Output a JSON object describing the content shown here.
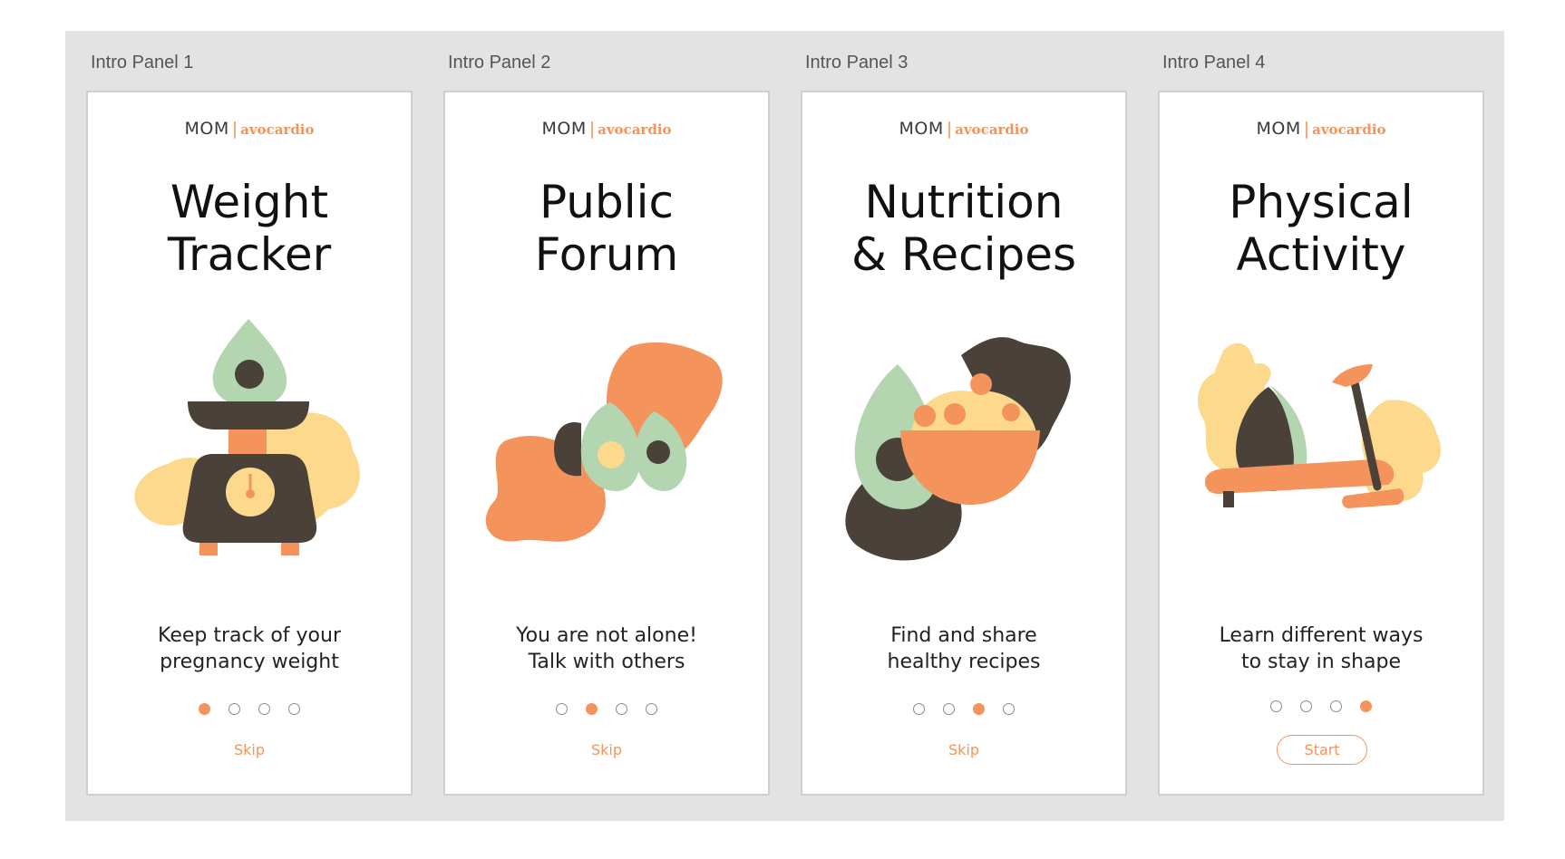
{
  "colors": {
    "accent": "#f4945c",
    "dark": "#4a4238",
    "green": "#b3d5b0",
    "yellow": "#fdd98e",
    "canvas": "#e3e3e3"
  },
  "brand": {
    "mom": "MOM",
    "separator": "|",
    "name": "avocardio"
  },
  "panels": [
    {
      "label": "Intro Panel 1",
      "title": [
        "Weight",
        "Tracker"
      ],
      "illustration": "avocado-on-scale-icon",
      "description": [
        "Keep track of your",
        "pregnancy weight"
      ],
      "active_step": 1,
      "action": "Skip"
    },
    {
      "label": "Intro Panel 2",
      "title": [
        "Public",
        "Forum"
      ],
      "illustration": "avocado-halves-chat-icon",
      "description": [
        "You are not alone!",
        "Talk with others"
      ],
      "active_step": 2,
      "action": "Skip"
    },
    {
      "label": "Intro Panel 3",
      "title": [
        "Nutrition",
        "& Recipes"
      ],
      "illustration": "avocado-food-bowl-icon",
      "description": [
        "Find and share",
        "healthy recipes"
      ],
      "active_step": 3,
      "action": "Skip"
    },
    {
      "label": "Intro Panel 4",
      "title": [
        "Physical",
        "Activity"
      ],
      "illustration": "avocado-exercise-bike-icon",
      "description": [
        "Learn different ways",
        "to stay in shape"
      ],
      "active_step": 4,
      "action": "Start"
    }
  ]
}
